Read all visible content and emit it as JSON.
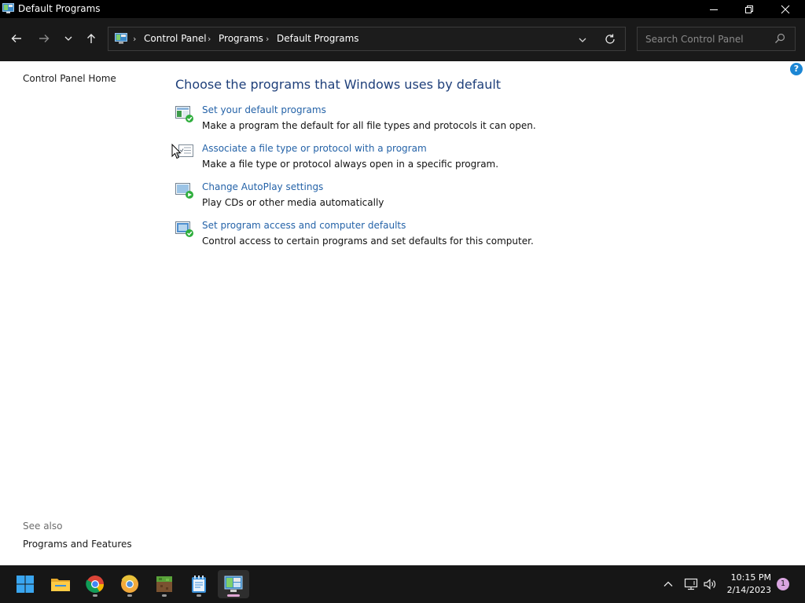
{
  "window": {
    "title": "Default Programs",
    "minimize_icon": "minimize-icon",
    "maximize_icon": "restore-icon",
    "close_icon": "close-icon"
  },
  "nav": {
    "back_icon": "back-arrow-icon",
    "forward_icon": "forward-arrow-icon",
    "recent_icon": "chevron-down-icon",
    "up_icon": "up-arrow-icon",
    "breadcrumbs": [
      "Control Panel",
      "Programs",
      "Default Programs"
    ],
    "search_placeholder": "Search Control Panel"
  },
  "sidebar": {
    "home_link": "Control Panel Home",
    "see_also_label": "See also",
    "see_also_links": [
      "Programs and Features"
    ]
  },
  "main": {
    "heading": "Choose the programs that Windows uses by default",
    "tasks": [
      {
        "link": "Set your default programs",
        "desc": "Make a program the default for all file types and protocols it can open."
      },
      {
        "link": "Associate a file type or protocol with a program",
        "desc": "Make a file type or protocol always open in a specific program."
      },
      {
        "link": "Change AutoPlay settings",
        "desc": "Play CDs or other media automatically"
      },
      {
        "link": "Set program access and computer defaults",
        "desc": "Control access to certain programs and set defaults for this computer."
      }
    ]
  },
  "taskbar": {
    "apps": [
      "start-icon",
      "file-explorer-icon",
      "chrome-icon",
      "chrome-canary-icon",
      "minecraft-icon",
      "notepad-icon",
      "control-panel-icon"
    ],
    "time": "10:15 PM",
    "date": "2/14/2023",
    "notification_count": "1"
  },
  "colors": {
    "accent": "#2563a8",
    "heading": "#1e3f7a",
    "titlebar": "#000000",
    "toolbar": "#191919",
    "taskbar": "#161616"
  }
}
